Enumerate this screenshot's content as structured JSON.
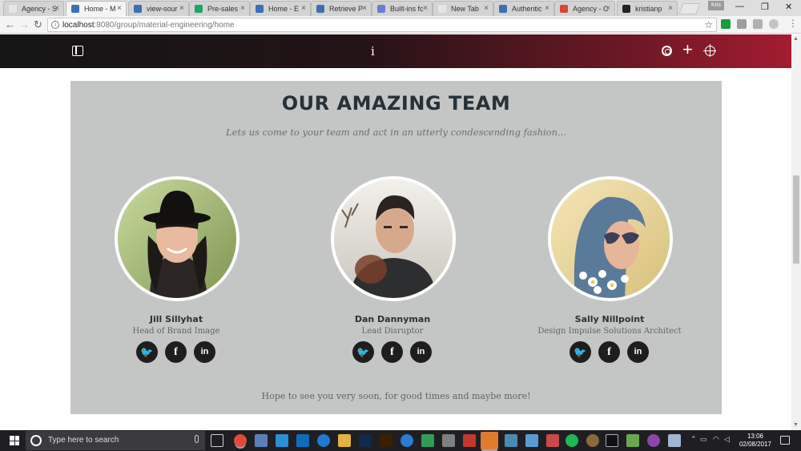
{
  "browser": {
    "tabs": [
      {
        "label": "Agency - S",
        "color": "#e6e6e6"
      },
      {
        "label": "Home - M",
        "color": "#3d6fb3"
      },
      {
        "label": "view-sour",
        "color": "#3d6fb3"
      },
      {
        "label": "Pre-sales",
        "color": "#1fa463"
      },
      {
        "label": "Home - E",
        "color": "#3d6fb3"
      },
      {
        "label": "Retrieve P",
        "color": "#3d6fb3"
      },
      {
        "label": "Built-ins fc",
        "color": "#6d7bd1"
      },
      {
        "label": "New Tab",
        "color": "#e6e6e6"
      },
      {
        "label": "Authentic",
        "color": "#3d6fb3"
      },
      {
        "label": "Agency - C",
        "color": "#d34836"
      },
      {
        "label": "kristianp",
        "color": "#222222"
      }
    ],
    "active_tab_index": 1,
    "profile_badge": "Kris",
    "url_host": "localhost",
    "url_path": ":8080/group/material-engineering/home"
  },
  "app": {
    "header_icons": [
      "sidebar-toggle-icon",
      "info-icon",
      "settings-gear-icon",
      "add-plus-icon",
      "target-icon"
    ],
    "gradient_colors": [
      "#151515",
      "#a41c30"
    ]
  },
  "team": {
    "title": "OUR AMAZING TEAM",
    "subtitle": "Lets us come to your team and act in an utterly condescending fashion...",
    "members": [
      {
        "name": "Jill Sillyhat",
        "role": "Head of Brand Image"
      },
      {
        "name": "Dan Dannyman",
        "role": "Lead Disruptor"
      },
      {
        "name": "Sally Nillpoint",
        "role": "Design Impulse Solutions Architect"
      }
    ],
    "social_glyphs": {
      "twitter": "🐦",
      "facebook": "f",
      "linkedin": "in"
    },
    "footer": "Hope to see you very soon, for good times and maybe more!"
  },
  "taskbar": {
    "search_placeholder": "Type here to search",
    "time": "13:06",
    "date": "02/08/2017"
  }
}
